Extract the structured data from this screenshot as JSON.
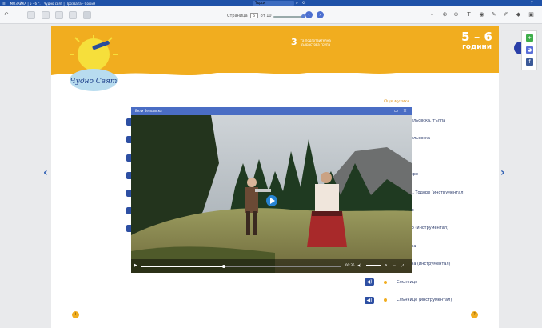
{
  "titlebar": {
    "title": "МОЗАЙКА | 5 - 6 г. | Чудно свят | Прозвата - София",
    "search_placeholder": "Търси",
    "help_icon": "question-icon",
    "menu_icon": "hamburger-icon"
  },
  "toolbar": {
    "page_label": "Страница",
    "page_value": "6",
    "page_total_label": "от 10"
  },
  "header": {
    "age_range": "5 – 6",
    "age_unit": "години",
    "group_number": "3",
    "group_line1": "та подготвителна",
    "group_line2": "възрастова група",
    "logo_text": "Чудно Свят"
  },
  "video": {
    "window_title": "Вели Бельовска",
    "time": "00:35"
  },
  "songs": {
    "section_title": "Още музика",
    "items": [
      "Вели Бельовска, тълпа",
      "Вели Бельовска",
      "…",
      "…, Тодоре",
      "…стани, Тодоре (инструментал)",
      "…, мамо",
      "…, мамо (инструментал)",
      "…Алтъна",
      "…Алтъна (инструментал)",
      "Слънчице",
      "Слънчице (инструментал)"
    ]
  },
  "colors": {
    "brand_blue": "#1f52a8",
    "header_orange": "#f1ad1f",
    "song_text": "#2a3a6a"
  }
}
